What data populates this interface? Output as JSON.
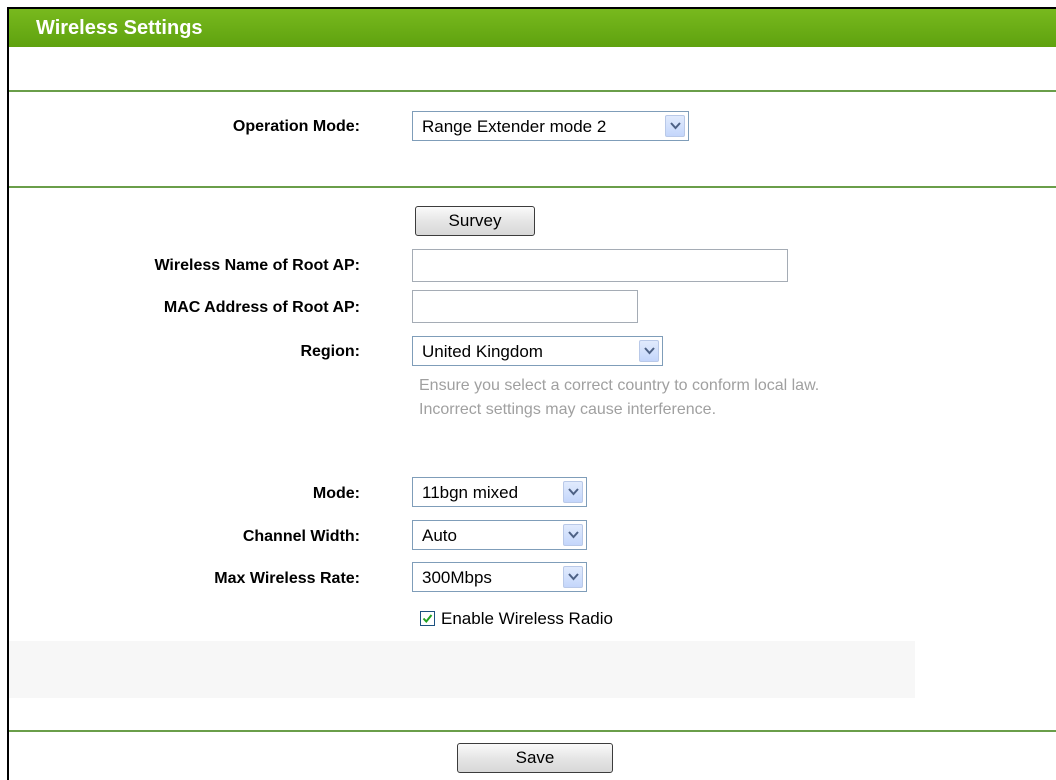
{
  "header": {
    "title": "Wireless Settings"
  },
  "operation_mode": {
    "label": "Operation Mode:",
    "value": "Range Extender mode 2"
  },
  "survey": {
    "label": "Survey"
  },
  "root_ap_name": {
    "label": "Wireless Name of Root AP:",
    "value": ""
  },
  "root_ap_mac": {
    "label": "MAC Address of Root AP:",
    "value": ""
  },
  "region": {
    "label": "Region:",
    "value": "United Kingdom",
    "hint_line1": "Ensure you select a correct country to conform local law.",
    "hint_line2": "Incorrect settings may cause interference."
  },
  "mode": {
    "label": "Mode:",
    "value": "11bgn mixed"
  },
  "channel_width": {
    "label": "Channel Width:",
    "value": "Auto"
  },
  "max_rate": {
    "label": "Max Wireless Rate:",
    "value": "300Mbps"
  },
  "enable_radio": {
    "label": "Enable Wireless Radio",
    "checked": true
  },
  "save": {
    "label": "Save"
  },
  "colors": {
    "header": "#6aab16",
    "divider": "#6a9e4a",
    "hint": "#a0a0a0"
  }
}
